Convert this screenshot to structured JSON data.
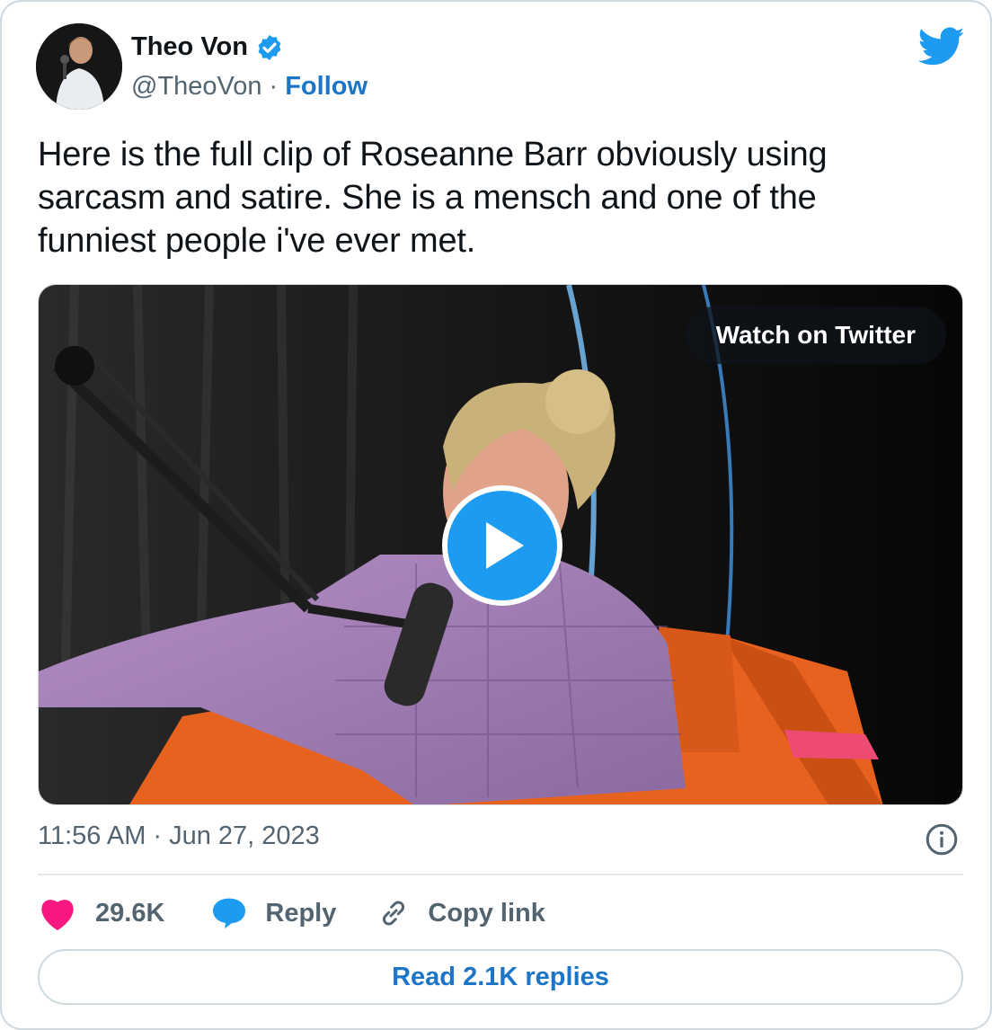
{
  "author": {
    "display_name": "Theo Von",
    "handle": "@TheoVon",
    "separator": "·",
    "follow_label": "Follow",
    "verified": true
  },
  "tweet": {
    "lines": [
      "Here is the full clip of Roseanne Barr obviously using",
      "sarcasm and satire.  She is a mensch and one of the",
      "funniest people i've ever met."
    ]
  },
  "media": {
    "watch_label": "Watch on Twitter",
    "play_icon": "play-icon"
  },
  "meta": {
    "time": "11:56 AM",
    "separator": "·",
    "date": "Jun 27, 2023"
  },
  "actions": {
    "likes": "29.6K",
    "reply_label": "Reply",
    "copy_link_label": "Copy link"
  },
  "read_replies_label": "Read 2.1K replies",
  "colors": {
    "twitter_blue": "#1d9bf0",
    "link_blue": "#1d75c8",
    "heart_pink": "#f91880",
    "muted_text": "#536471",
    "border": "#cfd9de"
  }
}
